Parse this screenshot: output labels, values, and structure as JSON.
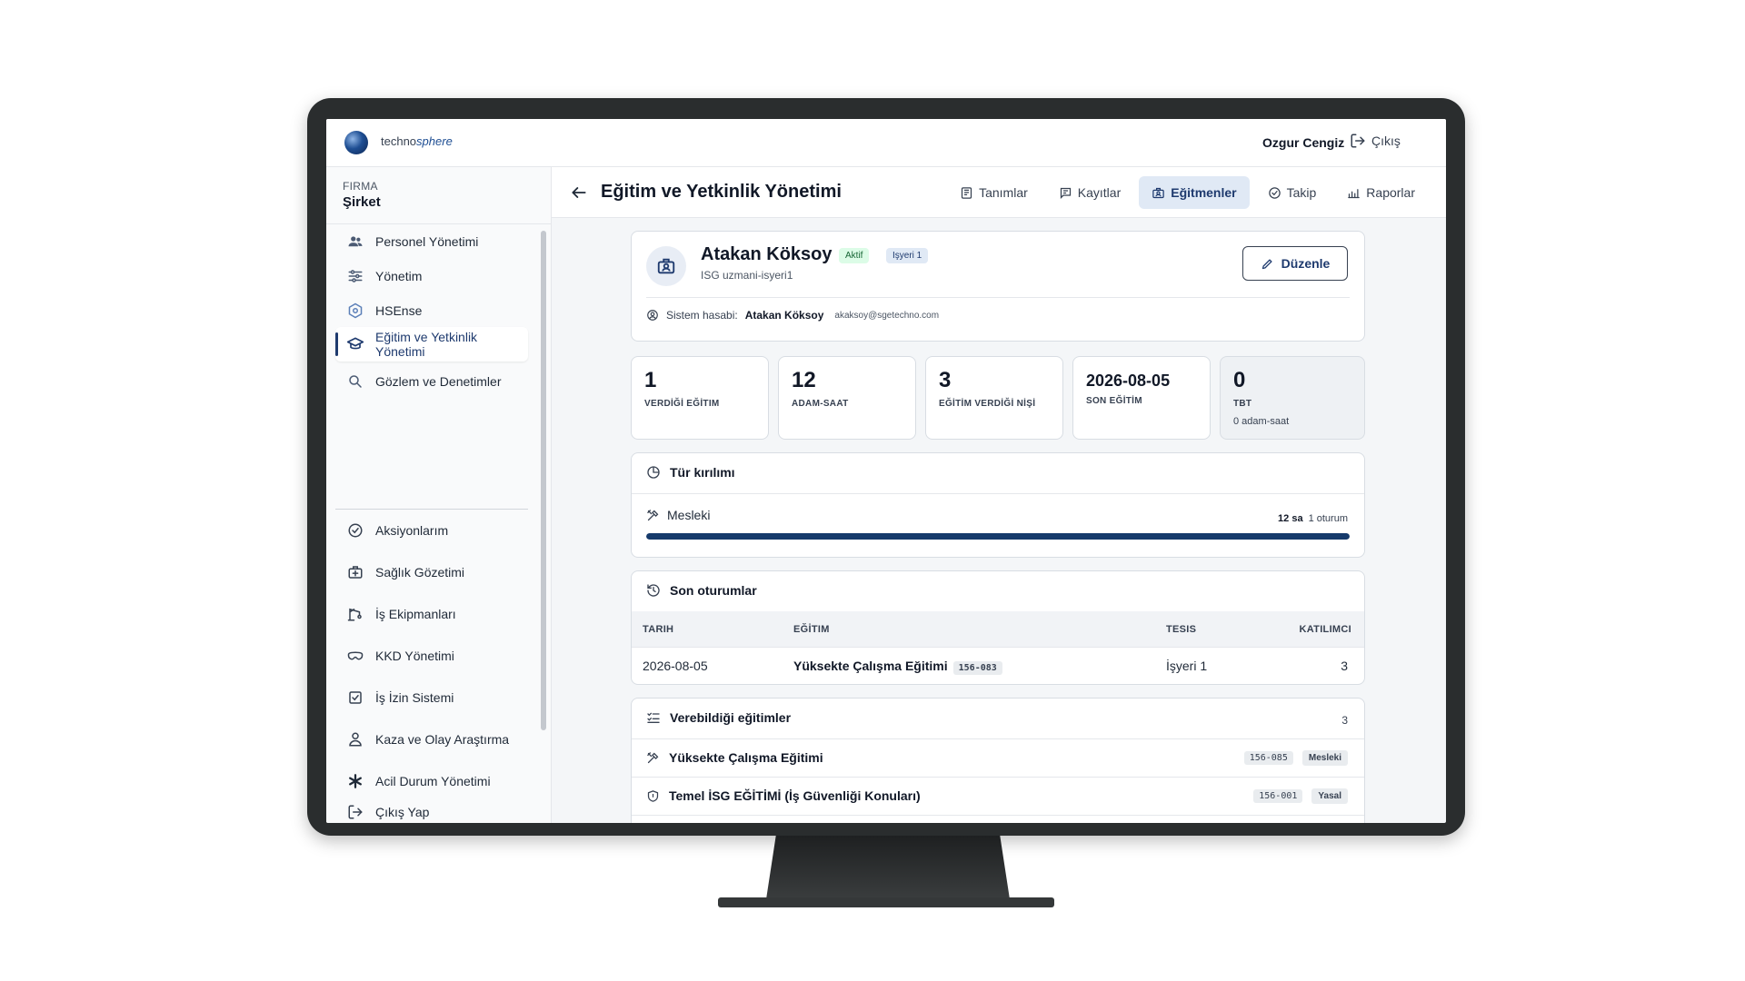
{
  "app": {
    "logo_prefix": "techno",
    "logo_suffix": "sphere"
  },
  "topbar": {
    "user_name": "Ozgur Cengiz",
    "logout_label": "Çıkış"
  },
  "sidebar": {
    "firma_label": "FIRMA",
    "firma_name": "Şirket",
    "items": [
      {
        "label": "Personel Yönetimi",
        "icon": "users-icon"
      },
      {
        "label": "Yönetim",
        "icon": "sliders-icon"
      },
      {
        "label": "HSEnse",
        "icon": "hexagon-icon"
      },
      {
        "label": "Eğitim ve Yetkinlik Yönetimi",
        "icon": "graduation-cap-icon",
        "active": true
      },
      {
        "label": "Gözlem ve Denetimler",
        "icon": "search-icon"
      },
      {
        "label": "Aksiyonlarım",
        "icon": "check-circle-icon"
      },
      {
        "label": "Sağlık Gözetimi",
        "icon": "medical-kit-icon"
      },
      {
        "label": "İş Ekipmanları",
        "icon": "crane-icon"
      },
      {
        "label": "KKD Yönetimi",
        "icon": "goggles-icon"
      },
      {
        "label": "İş İzin Sistemi",
        "icon": "checkbox-icon"
      },
      {
        "label": "Kaza ve Olay Araştırma",
        "icon": "person-alert-icon"
      },
      {
        "label": "Acil Durum Yönetimi",
        "icon": "asterisk-icon"
      }
    ],
    "logout_label": "Çıkış Yap"
  },
  "header": {
    "title": "Eğitim ve Yetkinlik Yönetimi",
    "tabs": [
      {
        "label": "Tanımlar",
        "icon": "book-icon"
      },
      {
        "label": "Kayıtlar",
        "icon": "records-icon"
      },
      {
        "label": "Eğitmenler",
        "icon": "instructor-icon",
        "active": true
      },
      {
        "label": "Takip",
        "icon": "check-circle-icon"
      },
      {
        "label": "Raporlar",
        "icon": "chart-icon"
      }
    ]
  },
  "profile": {
    "name": "Atakan Köksoy",
    "status_badge": "Aktif",
    "site_badge": "Işyeri 1",
    "role": "ISG uzmani-isyeri1",
    "edit_label": "Düzenle",
    "account_label": "Sistem hasabi:",
    "account_name": "Atakan Köksoy",
    "account_email": "akaksoy@sgetechno.com"
  },
  "stats": [
    {
      "value": "1",
      "label": "VERDİĞİ EĞİTIM"
    },
    {
      "value": "12",
      "label": "ADAM-SAAT"
    },
    {
      "value": "3",
      "label": "EĞİTİM VERDİĞİ NİŞİ"
    },
    {
      "value": "2026-08-05",
      "label": "SON EĞİTİM"
    },
    {
      "value": "0",
      "label": "TBT",
      "sub": "0 adam-saat"
    }
  ],
  "tur": {
    "title": "Tür kırılımı",
    "rows": [
      {
        "label": "Mesleki",
        "hours": "12 sa",
        "sessions": "1 oturum",
        "fraction": 1.0
      }
    ]
  },
  "sessions": {
    "title": "Son oturumlar",
    "columns": [
      "TARIH",
      "EĞİTIM",
      "TESIS",
      "KATILIMCI"
    ],
    "rows": [
      {
        "date": "2026-08-05",
        "training": "Yüksekte Çalışma Eğitimi",
        "code": "156-083",
        "site": "İşyeri 1",
        "count": "3"
      }
    ]
  },
  "capable": {
    "title": "Verebildiği eğitimler",
    "count": "3",
    "rows": [
      {
        "label": "Yüksekte Çalışma Eğitimi",
        "code": "156-085",
        "tag": "Mesleki",
        "icon": "tools-icon"
      },
      {
        "label": "Temel İSG EĞİTİMİ (İş Güvenliği Konuları)",
        "code": "156-001",
        "tag": "Yasal",
        "icon": "shield-icon"
      }
    ]
  }
}
